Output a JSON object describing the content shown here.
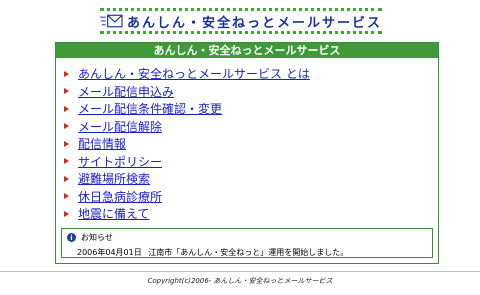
{
  "header": {
    "title": "あんしん・安全ねっとメールサービス",
    "icon": "mail-icon"
  },
  "main": {
    "box_title": "あんしん・安全ねっとメールサービス",
    "menu": [
      {
        "label": "あんしん・安全ねっとメールサービス とは"
      },
      {
        "label": "メール配信申込み"
      },
      {
        "label": "メール配信条件確認・変更"
      },
      {
        "label": "メール配信解除"
      },
      {
        "label": "配信情報"
      },
      {
        "label": "サイトポリシー"
      },
      {
        "label": "避難場所検索"
      },
      {
        "label": "休日急病診療所"
      },
      {
        "label": "地震に備えて"
      }
    ]
  },
  "notice": {
    "title": "お知らせ",
    "icon": "info-icon",
    "date": "2006年04月01日",
    "text": "江南市「あんしん・安全ねっと」運用を開始しました。"
  },
  "footer": {
    "copyright": "Copyright(c)2006- あんしん・安全ねっとメールサービス"
  },
  "colors": {
    "accent_green": "#3f9a3a",
    "link_blue": "#1a1fcc",
    "header_blue": "#1a2f9e",
    "arrow_red": "#d12a1a"
  }
}
